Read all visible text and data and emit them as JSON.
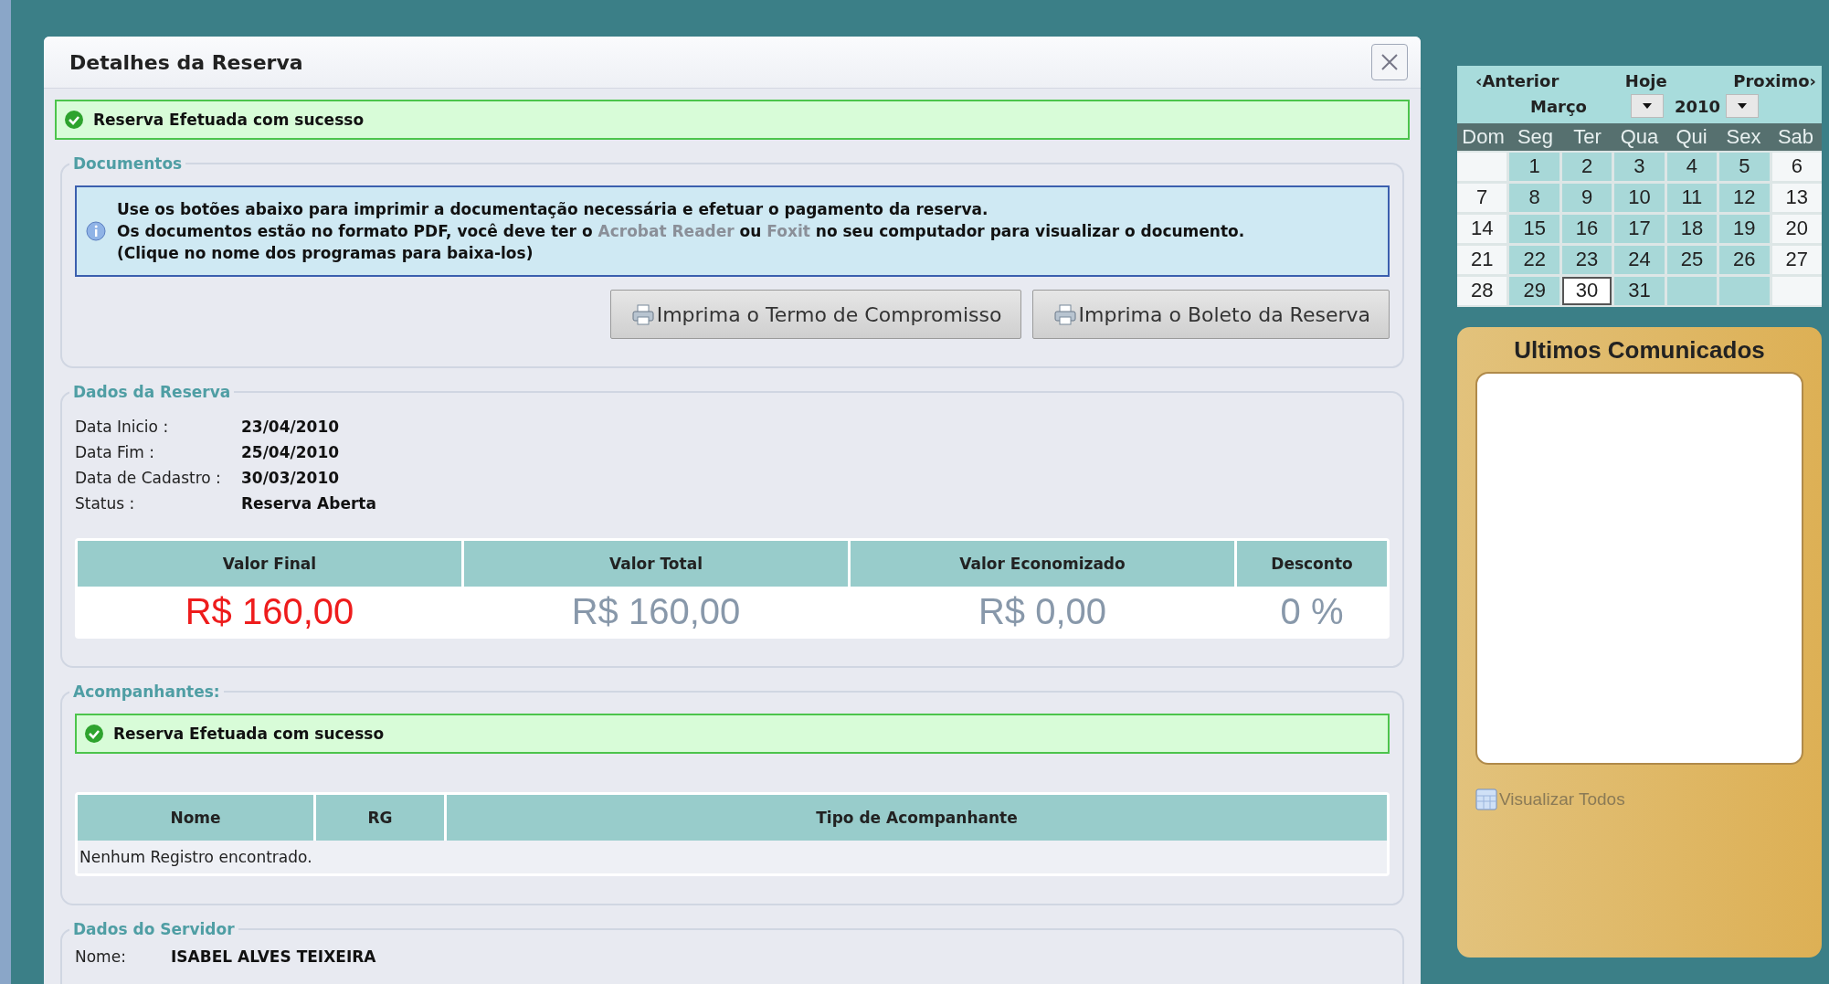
{
  "dialog": {
    "title": "Detalhes da Reserva",
    "success_message": "Reserva Efetuada com sucesso",
    "documentos": {
      "legend": "Documentos",
      "info_line1": "Use os botões abaixo para imprimir a documentação necessária e efetuar o pagamento da reserva.",
      "info_line2": {
        "text_parts": [
          "Os documentos estão no formato PDF, você deve ter o ",
          " ou ",
          " no seu computador para visualizar o documento."
        ],
        "links": [
          "Acrobat Reader",
          "Foxit"
        ]
      },
      "info_line3": "(Clique no nome dos programas para baixa-los)",
      "buttons": [
        "Imprima o Termo de Compromisso",
        "Imprima o Boleto da Reserva"
      ]
    },
    "dados_reserva": {
      "legend": "Dados da Reserva",
      "fields": [
        {
          "label": "Data Inicio :",
          "value": "23/04/2010"
        },
        {
          "label": "Data Fim :",
          "value": "25/04/2010"
        },
        {
          "label": "Data de Cadastro :",
          "value": "30/03/2010"
        },
        {
          "label": "Status :",
          "value": "Reserva Aberta"
        }
      ],
      "values_table": [
        {
          "header": "Valor Final",
          "value": "R$ 160,00",
          "emphasis": true
        },
        {
          "header": "Valor Total",
          "value": "R$ 160,00",
          "emphasis": false
        },
        {
          "header": "Valor Economizado",
          "value": "R$ 0,00",
          "emphasis": false
        },
        {
          "header": "Desconto",
          "value": "0 %",
          "emphasis": false
        }
      ]
    },
    "acompanhantes": {
      "legend": "Acompanhantes:",
      "success_message": "Reserva Efetuada com sucesso",
      "columns": [
        "Nome",
        "RG",
        "Tipo de Acompanhante"
      ],
      "empty_text": "Nenhum Registro encontrado."
    },
    "dados_servidor": {
      "legend": "Dados do Servidor",
      "fields": [
        {
          "label": "Nome:",
          "value": "ISABEL ALVES TEIXEIRA"
        }
      ]
    }
  },
  "calendar": {
    "prev": "‹Anterior",
    "today": "Hoje",
    "next": "Proximo›",
    "month": "Março",
    "year": "2010",
    "weekdays": [
      "Dom",
      "Seg",
      "Ter",
      "Qua",
      "Qui",
      "Sex",
      "Sab"
    ],
    "weeks": [
      [
        {
          "kind": "weekend",
          "selected": false
        },
        {
          "day": "1",
          "kind": "weekday",
          "selected": false
        },
        {
          "day": "2",
          "kind": "weekday",
          "selected": false
        },
        {
          "day": "3",
          "kind": "weekday",
          "selected": false
        },
        {
          "day": "4",
          "kind": "weekday",
          "selected": false
        },
        {
          "day": "5",
          "kind": "weekday",
          "selected": false
        },
        {
          "day": "6",
          "kind": "weekend",
          "selected": false
        }
      ],
      [
        {
          "day": "7",
          "kind": "weekend",
          "selected": false
        },
        {
          "day": "8",
          "kind": "weekday",
          "selected": false
        },
        {
          "day": "9",
          "kind": "weekday",
          "selected": false
        },
        {
          "day": "10",
          "kind": "weekday",
          "selected": false
        },
        {
          "day": "11",
          "kind": "weekday",
          "selected": false
        },
        {
          "day": "12",
          "kind": "weekday",
          "selected": false
        },
        {
          "day": "13",
          "kind": "weekend",
          "selected": false
        }
      ],
      [
        {
          "day": "14",
          "kind": "weekend",
          "selected": false
        },
        {
          "day": "15",
          "kind": "weekday",
          "selected": false
        },
        {
          "day": "16",
          "kind": "weekday",
          "selected": false
        },
        {
          "day": "17",
          "kind": "weekday",
          "selected": false
        },
        {
          "day": "18",
          "kind": "weekday",
          "selected": false
        },
        {
          "day": "19",
          "kind": "weekday",
          "selected": false
        },
        {
          "day": "20",
          "kind": "weekend",
          "selected": false
        }
      ],
      [
        {
          "day": "21",
          "kind": "weekend",
          "selected": false
        },
        {
          "day": "22",
          "kind": "weekday",
          "selected": false
        },
        {
          "day": "23",
          "kind": "weekday",
          "selected": false
        },
        {
          "day": "24",
          "kind": "weekday",
          "selected": false
        },
        {
          "day": "25",
          "kind": "weekday",
          "selected": false
        },
        {
          "day": "26",
          "kind": "weekday",
          "selected": false
        },
        {
          "day": "27",
          "kind": "weekend",
          "selected": false
        }
      ],
      [
        {
          "day": "28",
          "kind": "weekend",
          "selected": false
        },
        {
          "day": "29",
          "kind": "weekday",
          "selected": false
        },
        {
          "day": "30",
          "kind": "weekday",
          "selected": true
        },
        {
          "day": "31",
          "kind": "weekday",
          "selected": false
        },
        {
          "kind": "weekday",
          "selected": false
        },
        {
          "kind": "weekday",
          "selected": false
        },
        {
          "kind": "weekend",
          "selected": false
        }
      ]
    ]
  },
  "comunicados": {
    "title": "Ultimos Comunicados",
    "link": "Visualizar Todos"
  }
}
